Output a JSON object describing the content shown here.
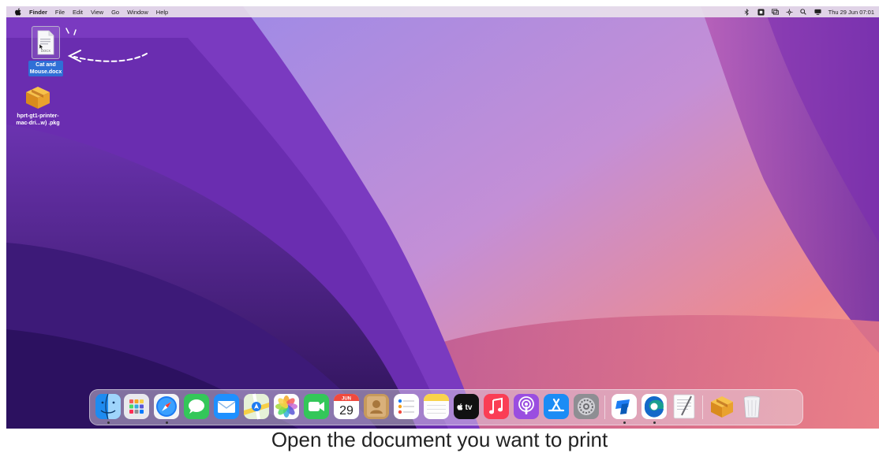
{
  "menubar": {
    "apple_icon": "apple-logo-icon",
    "app_name": "Finder",
    "menus": [
      "File",
      "Edit",
      "View",
      "Go",
      "Window",
      "Help"
    ],
    "status_icons": [
      "bluetooth-icon",
      "input-source-icon",
      "screen-mirroring-icon",
      "control-center-icon",
      "search-icon",
      "siri-icon"
    ],
    "clock": "Thu 29 Jun  07:01"
  },
  "desktop": {
    "icons": [
      {
        "name": "Cat and Mouse.docx",
        "label_line1": "Cat and",
        "label_line2": "Mouse.docx",
        "badge": "DOCX",
        "selected": true
      },
      {
        "name": "hprt-gt1-printer-mac-dri...w) .pkg",
        "label_line1": "hprt-gt1-printer-",
        "label_line2": "mac-dri...w) .pkg",
        "selected": false
      }
    ]
  },
  "dock": {
    "apps": [
      {
        "name": "Finder",
        "icon": "finder-icon",
        "running": true
      },
      {
        "name": "Launchpad",
        "icon": "launchpad-icon",
        "running": false
      },
      {
        "name": "Safari",
        "icon": "safari-icon",
        "running": true
      },
      {
        "name": "Messages",
        "icon": "messages-icon",
        "running": false
      },
      {
        "name": "Mail",
        "icon": "mail-icon",
        "running": false
      },
      {
        "name": "Maps",
        "icon": "maps-icon",
        "running": false
      },
      {
        "name": "Photos",
        "icon": "photos-icon",
        "running": false
      },
      {
        "name": "FaceTime",
        "icon": "facetime-icon",
        "running": false
      },
      {
        "name": "Calendar",
        "icon": "calendar-icon",
        "month": "JUN",
        "day": "29",
        "running": false
      },
      {
        "name": "Contacts",
        "icon": "contacts-icon",
        "running": false
      },
      {
        "name": "Reminders",
        "icon": "reminders-icon",
        "running": false
      },
      {
        "name": "Notes",
        "icon": "notes-icon",
        "running": false
      },
      {
        "name": "Apple TV",
        "icon": "apple-tv-icon",
        "label": "tv",
        "running": false
      },
      {
        "name": "Music",
        "icon": "music-icon",
        "running": false
      },
      {
        "name": "Podcasts",
        "icon": "podcasts-icon",
        "running": false
      },
      {
        "name": "App Store",
        "icon": "app-store-icon",
        "running": false
      },
      {
        "name": "System Settings",
        "icon": "system-settings-icon",
        "running": false
      },
      {
        "name": "Microsoft Remote Desktop",
        "icon": "remote-desktop-icon",
        "running": true
      },
      {
        "name": "Microsoft Edge",
        "icon": "edge-icon",
        "running": true
      },
      {
        "name": "TextEdit",
        "icon": "textedit-icon",
        "running": false
      },
      {
        "name": "Installer Package",
        "icon": "package-icon",
        "running": false
      },
      {
        "name": "Trash",
        "icon": "trash-icon",
        "running": false
      }
    ]
  },
  "caption": "Open the document you want to print",
  "colors": {
    "selection": "#2f6fd6",
    "wallpaper_dark": "#3a1a66",
    "wallpaper_mid": "#8a3fb0",
    "wallpaper_light": "#e8788a"
  }
}
